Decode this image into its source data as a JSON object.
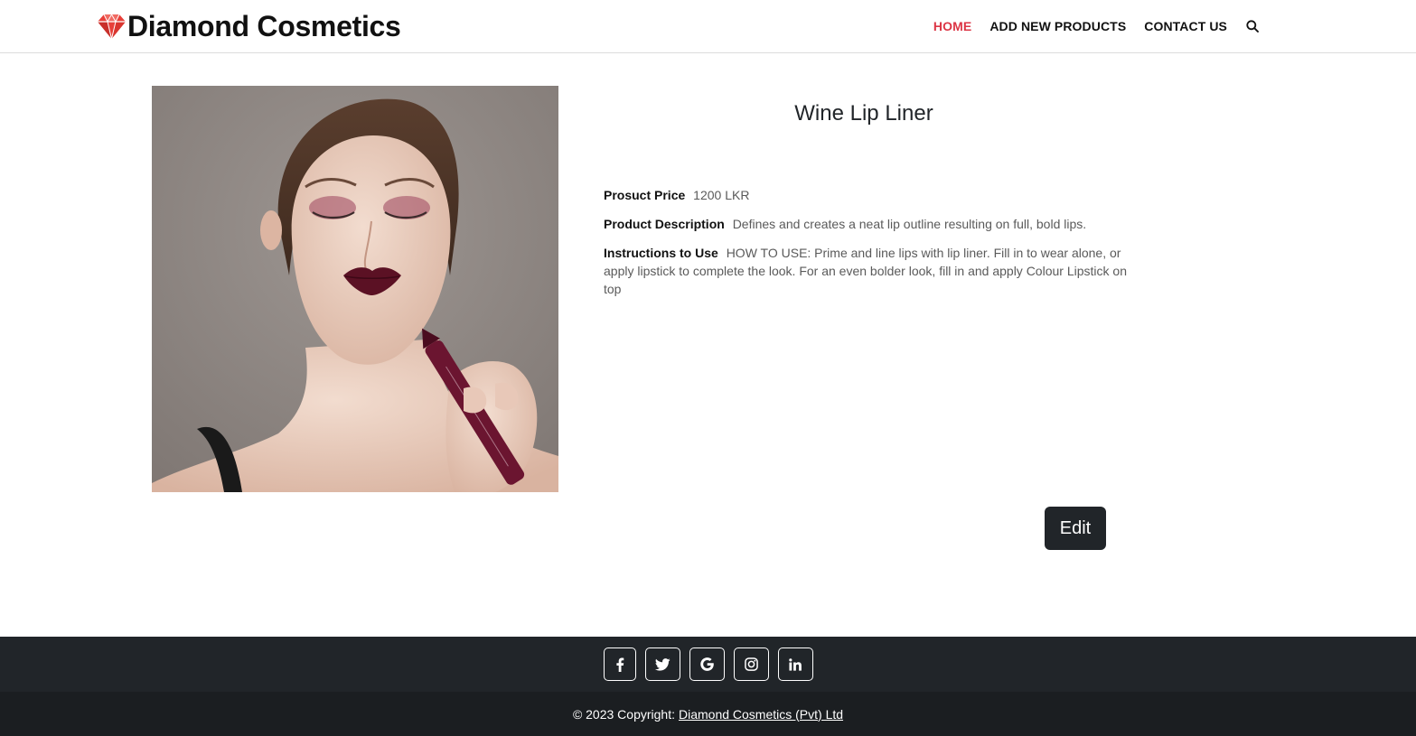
{
  "brand": {
    "name": "Diamond Cosmetics",
    "icon": "diamond-icon",
    "icon_color": "#e8403a"
  },
  "nav": {
    "items": [
      {
        "label": "HOME",
        "active": true
      },
      {
        "label": "ADD NEW PRODUCTS",
        "active": false
      },
      {
        "label": "CONTACT US",
        "active": false
      }
    ],
    "search_icon": "search-icon",
    "active_color": "#dc3545"
  },
  "product": {
    "title": "Wine Lip Liner",
    "image_alt": "Model holding a wine lip liner",
    "price_label": "Prosuct Price",
    "price_value": "1200 LKR",
    "description_label": "Product Description",
    "description_value": "Defines and creates a neat lip outline resulting on full, bold lips.",
    "instructions_label": "Instructions to Use",
    "instructions_value": "HOW TO USE: Prime and line lips with lip liner. Fill in to wear alone, or apply lipstick to complete the look. For an even bolder look, fill in and apply Colour Lipstick on top",
    "edit_label": "Edit"
  },
  "footer": {
    "social": [
      {
        "icon": "facebook-icon",
        "glyph": "f"
      },
      {
        "icon": "twitter-icon",
        "glyph": ""
      },
      {
        "icon": "google-icon",
        "glyph": "G"
      },
      {
        "icon": "instagram-icon",
        "glyph": ""
      },
      {
        "icon": "linkedin-icon",
        "glyph": "in"
      }
    ],
    "copyright_text": "© 2023 Copyright:",
    "copyright_link": "Diamond Cosmetics (Pvt) Ltd",
    "bg_top": "#212529",
    "bg_bottom": "#1b1e21"
  }
}
